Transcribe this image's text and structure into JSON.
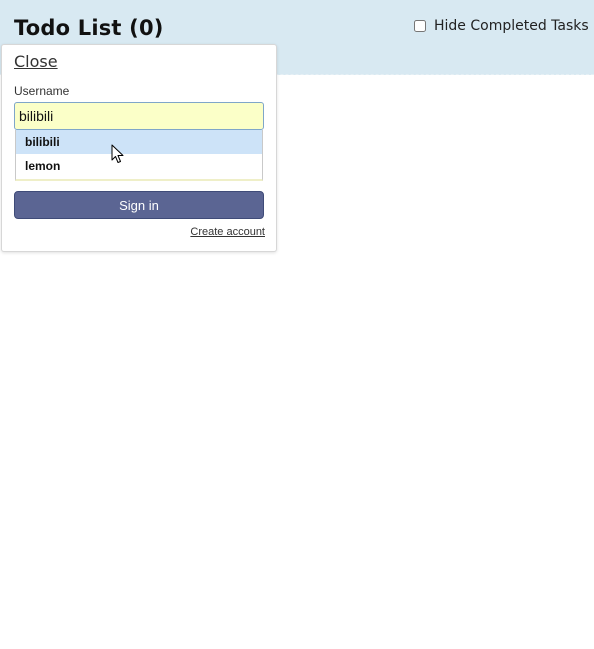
{
  "header": {
    "title": "Todo List (0)",
    "hide_completed_label": "Hide Completed Tasks",
    "hide_completed_checked": false,
    "background": "#d8e9f2"
  },
  "login": {
    "close_label": "Close",
    "username_label": "Username",
    "username_value": "bilibili",
    "suggestions": [
      "bilibili",
      "lemon"
    ],
    "active_suggestion": "bilibili",
    "sign_in_label": "Sign in",
    "create_account_label": "Create account",
    "button_color": "#5b6593"
  },
  "icons": {
    "cursor": "mouse-pointer-icon"
  }
}
